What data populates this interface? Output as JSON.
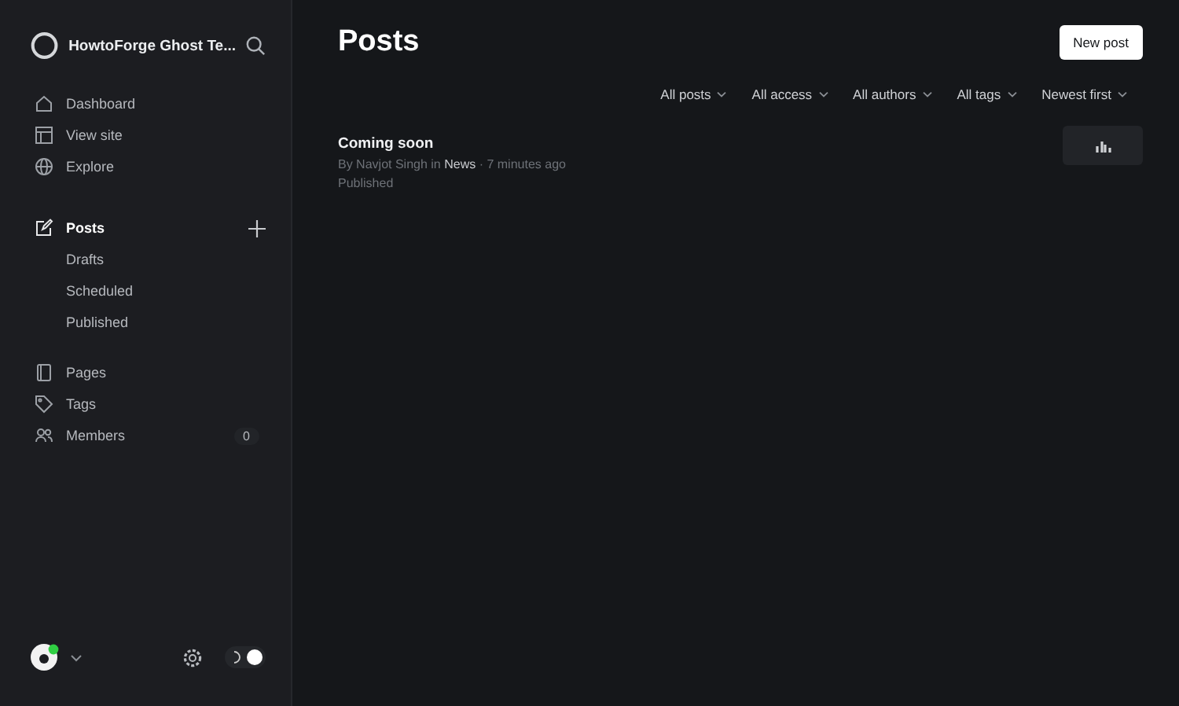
{
  "site": {
    "title": "HowtoForge Ghost Te..."
  },
  "nav_groups": [
    {
      "items": [
        {
          "label": "Dashboard",
          "selected": false
        },
        {
          "label": "View site",
          "selected": false
        },
        {
          "label": "Explore",
          "selected": false
        }
      ]
    },
    {
      "items": [
        {
          "label": "Posts",
          "selected": true,
          "children": [
            {
              "label": "Drafts",
              "selected": false
            },
            {
              "label": "Scheduled",
              "selected": false
            },
            {
              "label": "Published",
              "selected": false
            }
          ]
        }
      ]
    },
    {
      "items": [
        {
          "label": "Pages",
          "selected": false
        },
        {
          "label": "Tags",
          "selected": false
        },
        {
          "label": "Members",
          "selected": false,
          "count": "0"
        }
      ]
    }
  ],
  "footer": {
    "dark_mode": true
  },
  "page": {
    "title": "Posts",
    "new_button": "New post",
    "filters": [
      "All posts",
      "All access",
      "All authors",
      "All tags",
      "Newest first"
    ],
    "posts": [
      {
        "title": "Coming soon",
        "meta_prefix": "By Navjot Singh in",
        "tag": "News",
        "meta_suffix": "· 7 minutes ago",
        "status": "Published"
      }
    ]
  }
}
